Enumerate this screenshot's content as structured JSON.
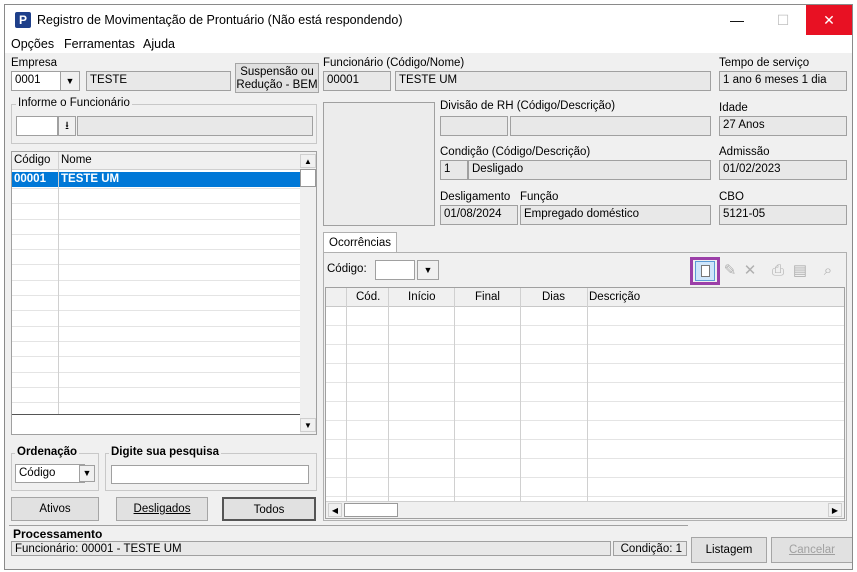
{
  "window": {
    "title": "Registro de Movimentação de Prontuário (Não está respondendo)",
    "minimize": "—",
    "maximize": "☐",
    "close": "✕"
  },
  "menu": [
    "Opções",
    "Ferramentas",
    "Ajuda"
  ],
  "empresa": {
    "label": "Empresa",
    "code": "0001",
    "name": "TESTE"
  },
  "suspensao_button": {
    "line1": "Suspensão ou",
    "line2": "Redução - BEM"
  },
  "informe": {
    "label": "Informe o Funcionário",
    "value": ""
  },
  "employee_list": {
    "headers": [
      "Código",
      "Nome"
    ],
    "rows": [
      {
        "code": "00001",
        "name": "TESTE UM"
      }
    ]
  },
  "ordenacao": {
    "label": "Ordenação",
    "value": "Código"
  },
  "pesquisa": {
    "label": "Digite sua pesquisa",
    "value": ""
  },
  "filter_buttons": {
    "ativos": "Ativos",
    "desligados": "Desligados",
    "todos": "Todos"
  },
  "funcionario": {
    "label": "Funcionário (Código/Nome)",
    "code": "00001",
    "name": "TESTE UM"
  },
  "tempo_servico": {
    "label": "Tempo de serviço",
    "value": "1 ano 6 meses 1 dia"
  },
  "divisao": {
    "label": "Divisão de RH (Código/Descrição)",
    "code": "",
    "desc": ""
  },
  "idade": {
    "label": "Idade",
    "value": "27 Anos"
  },
  "condicao": {
    "label": "Condição (Código/Descrição)",
    "code": "1",
    "desc": "Desligado"
  },
  "admissao": {
    "label": "Admissão",
    "value": "01/02/2023"
  },
  "desligamento": {
    "label": "Desligamento",
    "value": "01/08/2024"
  },
  "funcao": {
    "label": "Função",
    "value": "Empregado  doméstico"
  },
  "cbo": {
    "label": "CBO",
    "value": "5121-05"
  },
  "ocorrencias": {
    "tab": "Ocorrências",
    "codigo_label": "Código:",
    "codigo_value": "",
    "headers": [
      "Cód.",
      "Início",
      "Final",
      "Dias",
      "Descrição"
    ]
  },
  "processamento": {
    "label": "Processamento",
    "status": "Funcionário: 00001 - TESTE UM",
    "condicao": "Condição: 1"
  },
  "actions": {
    "listagem": "Listagem",
    "cancelar": "Cancelar"
  },
  "colors": {
    "selection": "#0078d7",
    "highlight_border": "#9b3fa8",
    "close_red": "#e81123"
  }
}
